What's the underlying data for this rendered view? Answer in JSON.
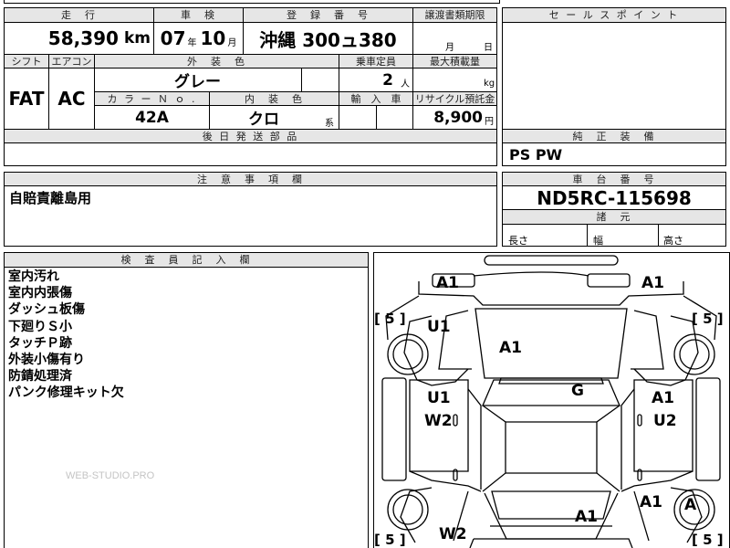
{
  "sheet": {
    "headers": {
      "mileage": "走　行",
      "inspection": "車　検",
      "registration": "登　録　番　号",
      "transfer_deadline": "譲渡書類期限",
      "sale_points": "セ ー ル ス ポ イ ン ト",
      "shift": "シフト",
      "aircon": "エアコン",
      "exterior_color": "外　装　色",
      "capacity": "乗車定員",
      "max_load": "最大積載量",
      "color_no": "カ ラ ー Ｎ ｏ .",
      "interior_color": "内　装　色",
      "import": "輸　入　車",
      "recycle_fee": "リサイクル預託金",
      "later_parts": "後 日 発 送 部 品",
      "standard_equipment": "純　正　装　備",
      "notes": "注　意　事　項　欄",
      "chassis_no": "車　台　番　号",
      "dimensions": "諸　元",
      "inspector_notes": "検　査　員　記　入　欄"
    },
    "values": {
      "mileage": "58,390",
      "mileage_unit": "km",
      "inspection_year": "07",
      "year_unit": "年",
      "inspection_month": "10",
      "month_unit": "月",
      "registration": "沖縄 300ュ380",
      "transfer_month_unit": "月",
      "transfer_day_unit": "日",
      "shift": "FAT",
      "aircon": "AC",
      "exterior_color": "グレー",
      "capacity": "2",
      "capacity_unit": "人",
      "max_load_unit": "kg",
      "color_no": "42A",
      "interior_color": "クロ",
      "interior_suffix": "系",
      "recycle_fee": "8,900",
      "recycle_unit": "円",
      "standard_equipment": "PS PW",
      "chassis_no": "ND5RC-115698",
      "length_label": "長さ",
      "width_label": "幅",
      "height_label": "高さ"
    },
    "notes": [
      "自賠責離島用"
    ],
    "inspector_notes": [
      "室内汚れ",
      "室内内張傷",
      "ダッシュ板傷",
      "下廻りＳ小",
      "タッチＰ跡",
      "外装小傷有り",
      "防錆処理済",
      "パンク修理キット欠"
    ],
    "watermark": "WEB-STUDIO.PRO"
  },
  "damage_marks": {
    "a1_front_left": "A1",
    "a1_front_right": "A1",
    "u1_left_fender": "U1",
    "a1_hood": "A1",
    "g_windshield": "G",
    "u1_left_door": "U1",
    "w2_left_door": "W2",
    "a1_right_door": "A1",
    "u2_right_door": "U2",
    "a1_right_rear": "A1",
    "a_right_rear_wheel": "A",
    "a1_trunk": "A1",
    "w2_left_rear": "W2",
    "tire_front_left": "[ 5 ]",
    "tire_front_right": "[ 5 ]",
    "tire_rear_left": "[ 5 ]",
    "tire_rear_right": "[ 5 ]"
  }
}
